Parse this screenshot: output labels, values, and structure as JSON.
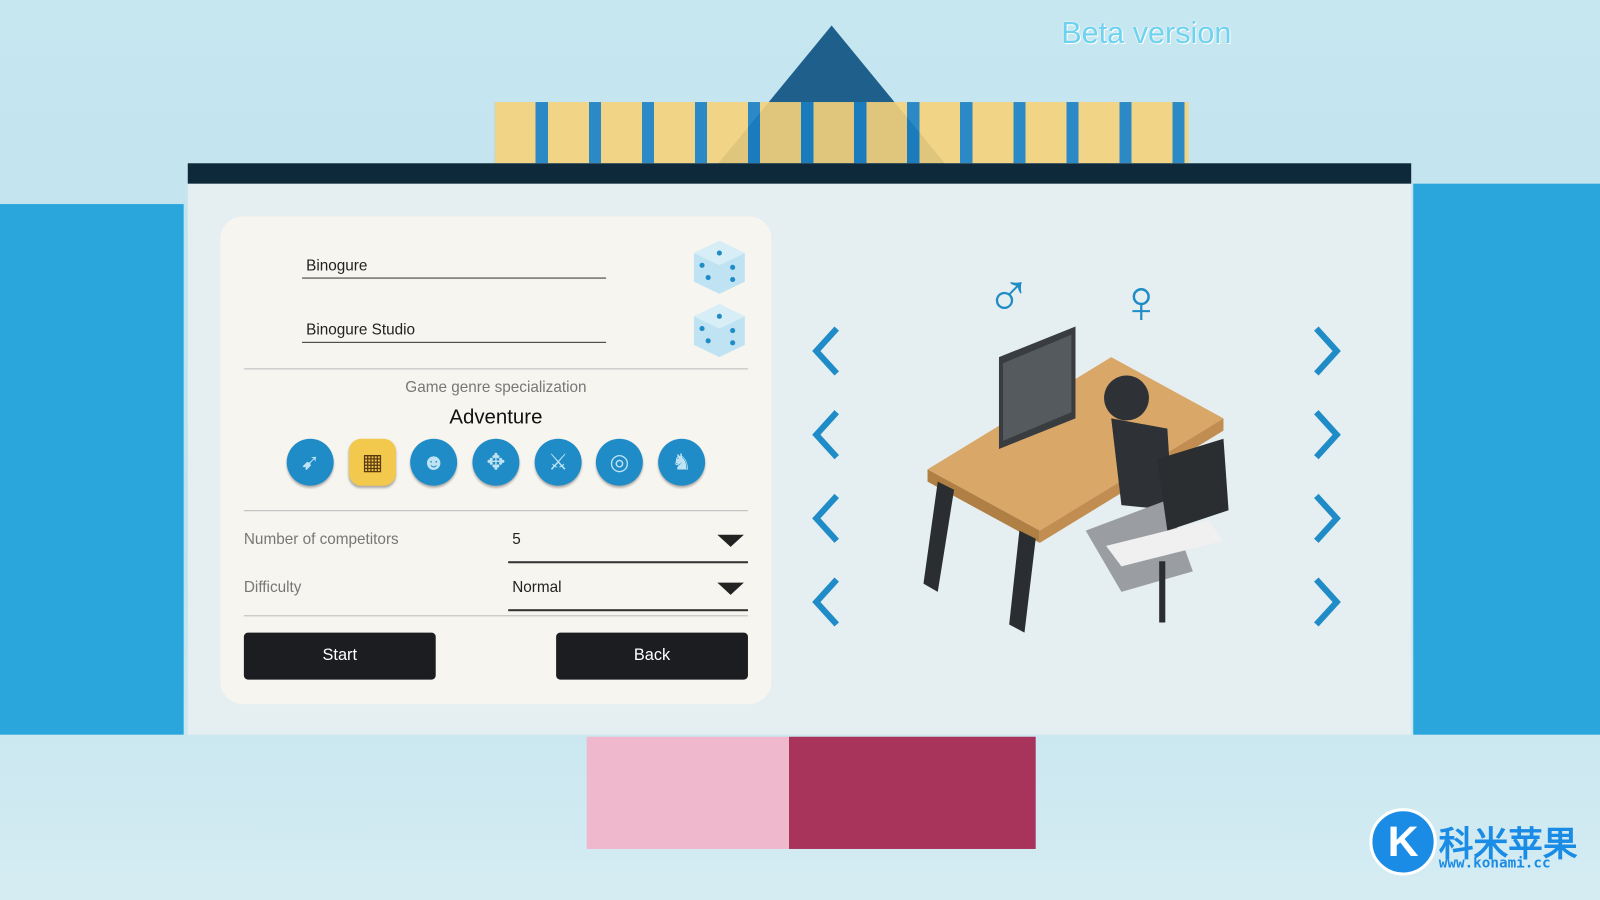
{
  "beta_label": "Beta version",
  "form": {
    "player_name": "Binogure",
    "studio_name": "Binogure Studio",
    "genre_heading": "Game genre specialization",
    "selected_genre": "Adventure",
    "genres": [
      {
        "icon": "revolver-icon",
        "selected": false
      },
      {
        "icon": "map-icon",
        "selected": true
      },
      {
        "icon": "people-icon",
        "selected": false
      },
      {
        "icon": "puzzle-icon",
        "selected": false
      },
      {
        "icon": "sword-shield-icon",
        "selected": false
      },
      {
        "icon": "vr-icon",
        "selected": false
      },
      {
        "icon": "chess-knight-icon",
        "selected": false
      }
    ],
    "competitors_label": "Number of competitors",
    "competitors_value": "5",
    "difficulty_label": "Difficulty",
    "difficulty_value": "Normal",
    "start_label": "Start",
    "back_label": "Back"
  },
  "avatar": {
    "male_symbol": "♂",
    "female_symbol": "♀"
  },
  "watermark": {
    "text": "科米苹果",
    "url": "www.konami.cc"
  },
  "colors": {
    "accent": "#1f8cc7",
    "selected_genre": "#f2c94c",
    "header": "#0e2a3a",
    "button": "#1b1d20"
  }
}
